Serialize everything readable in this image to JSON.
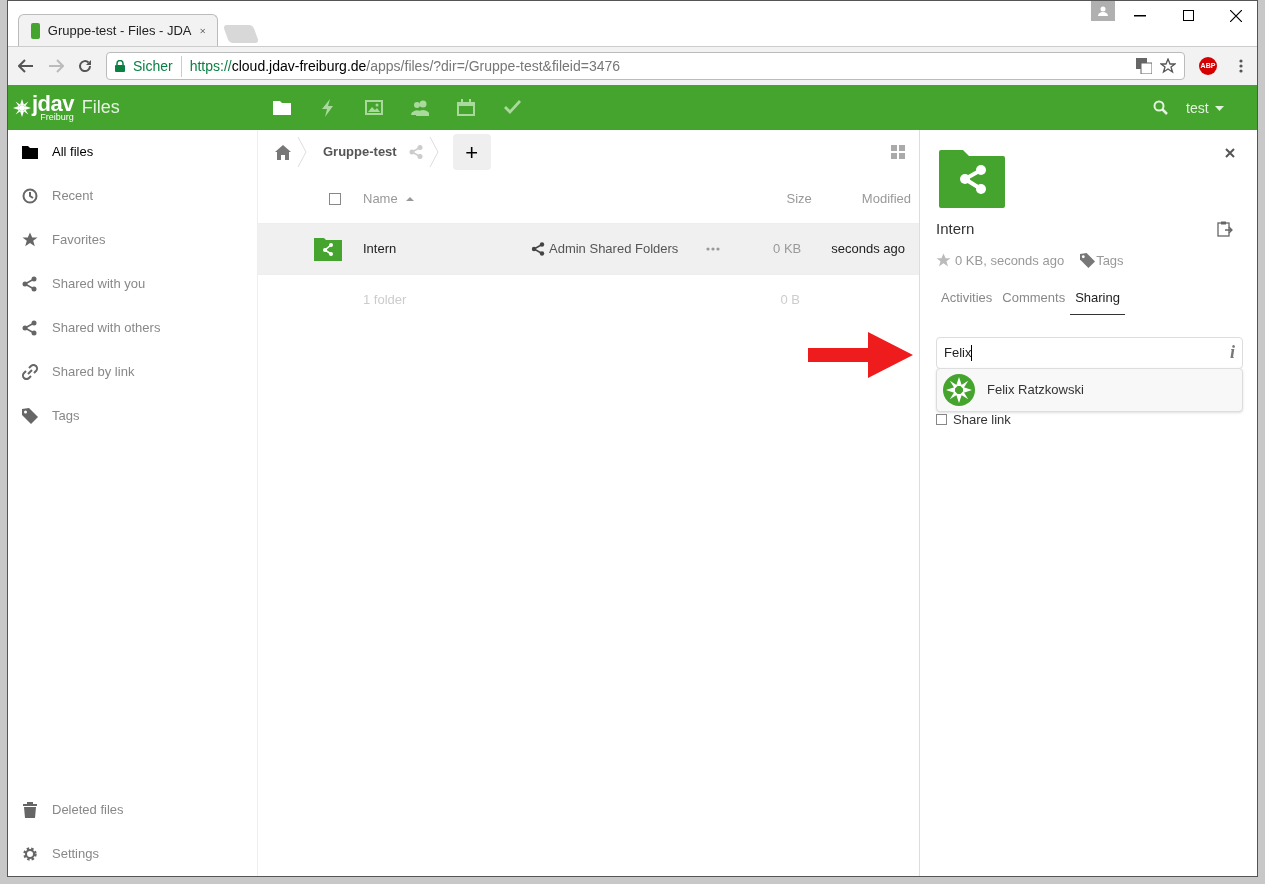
{
  "browser": {
    "tab_title": "Gruppe-test - Files - JDA",
    "security": "Sicher",
    "url_scheme": "https://",
    "url_host": "cloud.jdav-freiburg.de",
    "url_path": "/apps/files/?dir=/Gruppe-test&fileid=3476",
    "extension_badge": "ABP"
  },
  "header": {
    "logo_text": "jdav",
    "logo_sub": "Freiburg",
    "app_name": "Files",
    "user": "test",
    "apps": [
      {
        "kind": "files",
        "selected": true
      },
      {
        "kind": "activity",
        "selected": false
      },
      {
        "kind": "gallery",
        "selected": false
      },
      {
        "kind": "contacts",
        "selected": false
      },
      {
        "kind": "calendar",
        "selected": false
      },
      {
        "kind": "tasks",
        "selected": false
      }
    ]
  },
  "sidebar": {
    "items": [
      {
        "kind": "folder",
        "label": "All files",
        "selected": true
      },
      {
        "kind": "clock",
        "label": "Recent",
        "selected": false
      },
      {
        "kind": "star",
        "label": "Favorites",
        "selected": false
      },
      {
        "kind": "share",
        "label": "Shared with you",
        "selected": false
      },
      {
        "kind": "share",
        "label": "Shared with others",
        "selected": false
      },
      {
        "kind": "link",
        "label": "Shared by link",
        "selected": false
      },
      {
        "kind": "tag",
        "label": "Tags",
        "selected": false
      }
    ],
    "bottom": [
      {
        "kind": "trash",
        "label": "Deleted files"
      },
      {
        "kind": "gear",
        "label": "Settings"
      }
    ]
  },
  "breadcrumb": {
    "folder": "Gruppe-test",
    "new_button": "+"
  },
  "table": {
    "select_all_checked": false,
    "columns": [
      "Name",
      "Size",
      "Modified"
    ],
    "rows": [
      {
        "name": "Intern",
        "share_owner": "Admin Shared Folders",
        "size": "0 KB",
        "modified": "seconds ago",
        "selected": true
      }
    ],
    "summary": {
      "count": "1 folder",
      "size": "0 B"
    }
  },
  "details": {
    "name": "Intern",
    "meta": "0 KB, seconds ago",
    "tags": "Tags",
    "tabs": [
      {
        "label": "Activities",
        "selected": false
      },
      {
        "label": "Comments",
        "selected": false
      },
      {
        "label": "Sharing",
        "selected": true
      }
    ],
    "share_input": "Felix",
    "info": "i",
    "suggestions": [
      {
        "name": "Felix Ratzkowski"
      }
    ],
    "share_link": {
      "label": "Share link",
      "checked": false
    }
  }
}
